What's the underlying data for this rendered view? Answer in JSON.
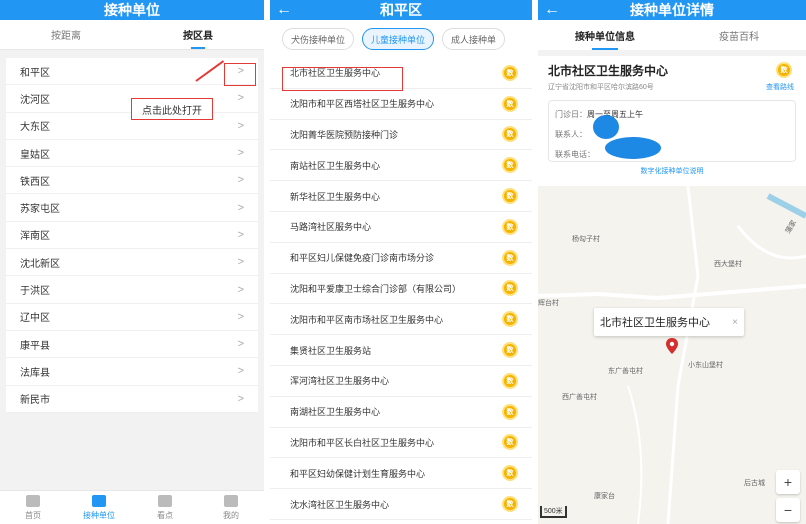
{
  "screen1": {
    "title": "接种单位",
    "tabs": [
      "按距离",
      "按区县"
    ],
    "districts": [
      "和平区",
      "沈河区",
      "大东区",
      "皇姑区",
      "铁西区",
      "苏家屯区",
      "浑南区",
      "沈北新区",
      "于洪区",
      "辽中区",
      "康平县",
      "法库县",
      "新民市"
    ],
    "callout": "点击此处打开",
    "bottom_nav": [
      "首页",
      "接种单位",
      "看点",
      "我的"
    ]
  },
  "screen2": {
    "title": "和平区",
    "chips": [
      "犬伤接种单位",
      "儿童接种单位",
      "成人接种单"
    ],
    "units": [
      "北市社区卫生服务中心",
      "沈阳市和平区西塔社区卫生服务中心",
      "沈阳菁华医院预防接种门诊",
      "南站社区卫生服务中心",
      "新华社区卫生服务中心",
      "马路湾社区服务中心",
      "和平区妇儿保健免疫门诊南市场分诊",
      "沈阳和平爱康卫士综合门诊部（有限公司）",
      "沈阳市和平区南市场社区卫生服务中心",
      "集贤社区卫生服务站",
      "浑河湾社区卫生服务中心",
      "南湖社区卫生服务中心",
      "沈阳市和平区长白社区卫生服务中心",
      "和平区妇幼保健计划生育服务中心",
      "沈水湾社区卫生服务中心"
    ],
    "badge": "数"
  },
  "screen3": {
    "title": "接种单位详情",
    "tabs": [
      "接种单位信息",
      "疫苗百科"
    ],
    "name": "北市社区卫生服务中心",
    "address": "辽宁省沈阳市和平区哈尔滨路60号",
    "route": "查看路线",
    "clinic_day_label": "门诊日：",
    "clinic_day_value": "周一至周五上午",
    "contact_person_label": "联系人：",
    "contact_phone_label": "联系电话：",
    "digital_note": "数字化接种单位说明",
    "map_labels": [
      "杨勾子村",
      "西大堡村",
      "辉台村",
      "东广善屯村",
      "小东山堡村",
      "西广善屯村",
      "康家台",
      "后古城",
      "蒲家"
    ],
    "popup": "北市社区卫生服务中心",
    "scale": "500米",
    "zoom_in": "+",
    "zoom_out": "−"
  }
}
